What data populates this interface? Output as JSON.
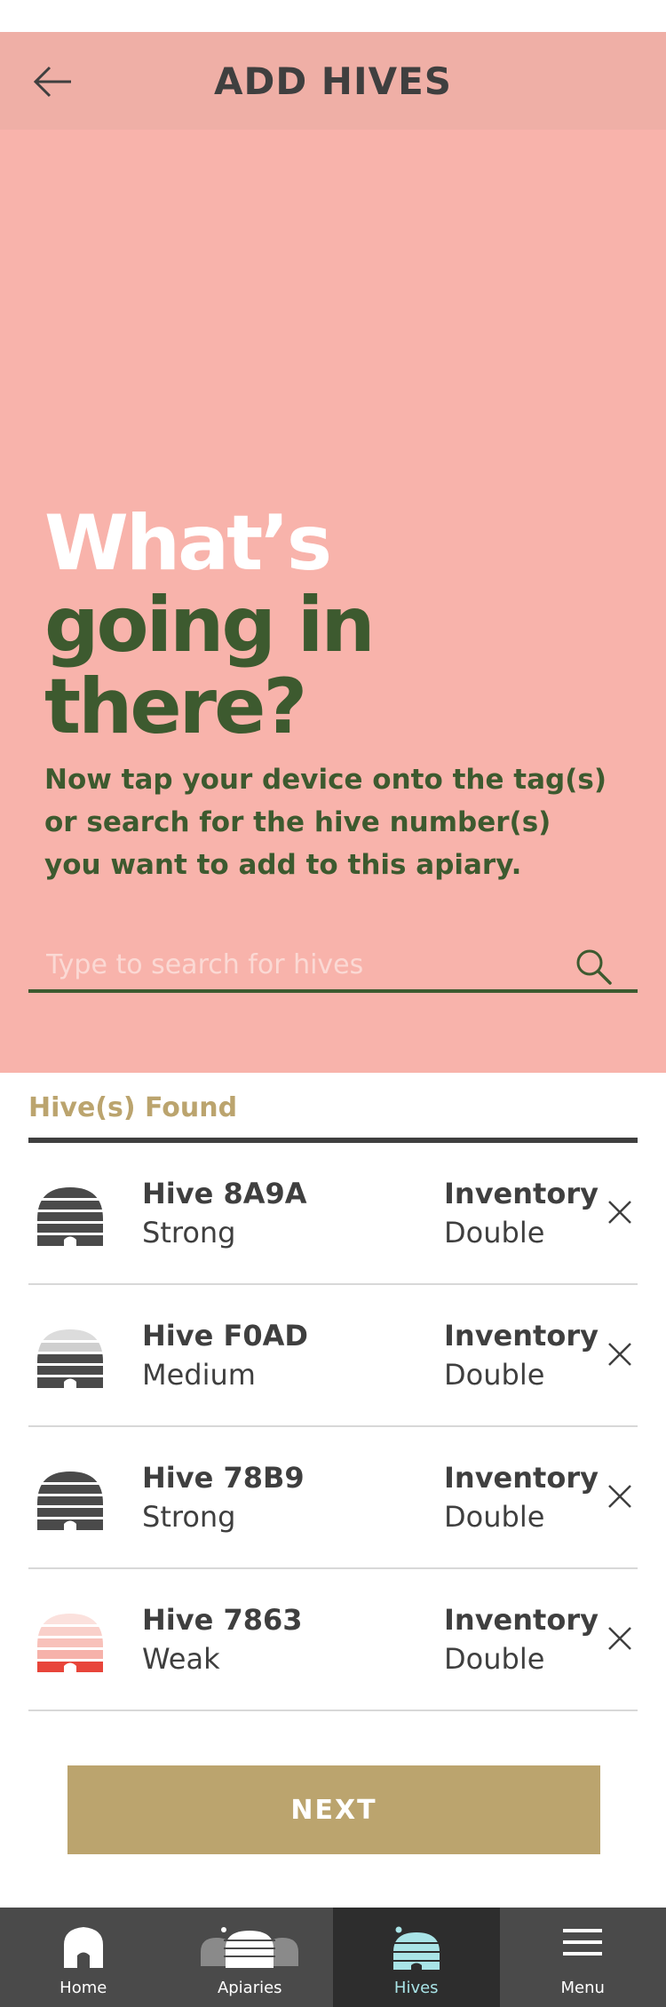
{
  "header": {
    "title": "ADD HIVES",
    "back_icon": "arrow-left-icon"
  },
  "hero": {
    "headline_line1": "What’s",
    "headline_line2": "going in",
    "headline_line3": "there?",
    "subtext": "Now tap your device onto the tag(s) or search for the hive number(s) you want to add to this apiary.",
    "search_placeholder": "Type to search for hives",
    "search_value": "",
    "search_icon": "search-icon"
  },
  "results": {
    "label": "Hive(s) Found",
    "hives": [
      {
        "name": "Hive 8A9A",
        "strength": "Strong",
        "location_label": "Inventory",
        "location_value": "Double",
        "icon": "hive-strong-icon"
      },
      {
        "name": "Hive F0AD",
        "strength": "Medium",
        "location_label": "Inventory",
        "location_value": "Double",
        "icon": "hive-medium-icon"
      },
      {
        "name": "Hive 78B9",
        "strength": "Strong",
        "location_label": "Inventory",
        "location_value": "Double",
        "icon": "hive-strong-icon"
      },
      {
        "name": "Hive 7863",
        "strength": "Weak",
        "location_label": "Inventory",
        "location_value": "Double",
        "icon": "hive-weak-icon"
      }
    ]
  },
  "next_label": "NEXT",
  "tabs": [
    {
      "label": "Home",
      "icon": "home-icon",
      "active": false
    },
    {
      "label": "Apiaries",
      "icon": "apiaries-icon",
      "active": false
    },
    {
      "label": "Hives",
      "icon": "hive-icon",
      "active": true
    },
    {
      "label": "Menu",
      "icon": "menu-icon",
      "active": false
    }
  ],
  "colors": {
    "header_bg": "#efafa6",
    "hero_bg": "#f8b3ab",
    "headline_green": "#3d5a2f",
    "accent_gold": "#bba46e",
    "tabbar_bg": "#4a4a4a",
    "tab_active_bg": "#2d2d2d",
    "tab_active_color": "#a9e4e7",
    "weak_red": "#e8453a"
  }
}
